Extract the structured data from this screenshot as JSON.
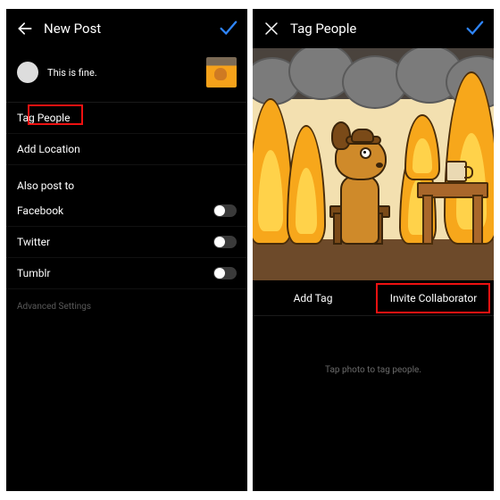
{
  "left": {
    "title": "New Post",
    "caption": "This is fine.",
    "tag_people_label": "Tag People",
    "add_location_label": "Add Location",
    "also_post_to_label": "Also post to",
    "social": {
      "facebook": "Facebook",
      "twitter": "Twitter",
      "tumblr": "Tumblr"
    },
    "advanced_settings_label": "Advanced Settings"
  },
  "right": {
    "title": "Tag People",
    "add_tag_label": "Add Tag",
    "invite_collaborator_label": "Invite Collaborator",
    "hint": "Tap photo to tag people."
  }
}
